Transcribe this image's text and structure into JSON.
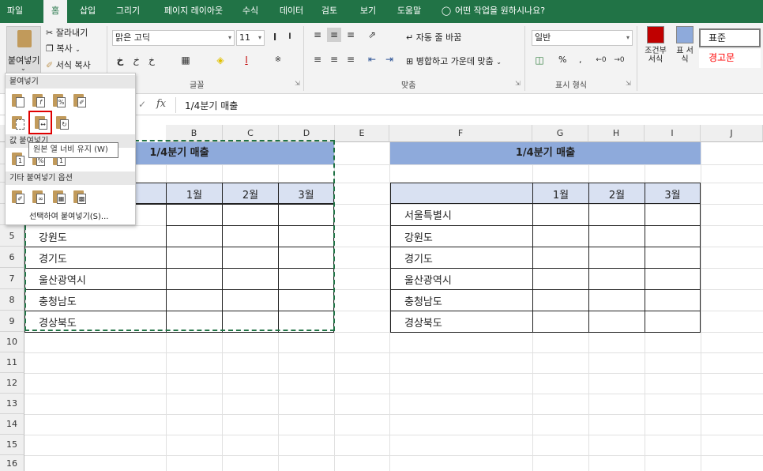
{
  "tabs": [
    "파일",
    "홈",
    "삽입",
    "그리기",
    "페이지 레이아웃",
    "수식",
    "데이터",
    "검토",
    "보기",
    "도움말"
  ],
  "active_tab": "홈",
  "tell_me": "어떤 작업을 원하시나요?",
  "ribbon": {
    "clipboard": {
      "paste": "붙여넣기",
      "cut": "잘라내기",
      "copy": "복사",
      "format_painter": "서식 복사"
    },
    "font": {
      "name": "맑은 고딕",
      "size": "11",
      "group_label": "글꼴"
    },
    "alignment": {
      "wrap_text": "자동 줄 바꿈",
      "merge_center": "병합하고 가운데 맞춤",
      "group_label": "맞춤"
    },
    "number": {
      "format": "일반",
      "percent": "%",
      "comma": ",",
      "group_label": "표시 형식"
    },
    "styles": {
      "conditional": "조건부 서식",
      "table": "표 서식",
      "normal": "표준",
      "warning": "경고문"
    }
  },
  "formula_bar": {
    "fx": "fx",
    "formula": "1/4분기 매출"
  },
  "columns": [
    "B",
    "C",
    "D",
    "E",
    "F",
    "G",
    "H",
    "I",
    "J"
  ],
  "rows": [
    "5",
    "6",
    "7",
    "8",
    "9",
    "10",
    "11",
    "12",
    "13",
    "14",
    "15",
    "16"
  ],
  "left_table": {
    "title": "1/4분기 매출",
    "months": [
      "1월",
      "2월",
      "3월"
    ],
    "regions": [
      "강원도",
      "경기도",
      "울산광역시",
      "충청남도",
      "경상북도"
    ]
  },
  "right_table": {
    "title": "1/4분기 매출",
    "months": [
      "1월",
      "2월",
      "3월"
    ],
    "regions": [
      "서울특별시",
      "강원도",
      "경기도",
      "울산광역시",
      "충청남도",
      "경상북도"
    ]
  },
  "paste_menu": {
    "section_paste": "붙여넣기",
    "section_values": "값 붙여넣기",
    "section_other": "기타 붙여넣기 옵션",
    "tooltip": "원본 열 너비 유지 (W)",
    "paste_special": "선택하여 붙여넣기(S)..."
  }
}
